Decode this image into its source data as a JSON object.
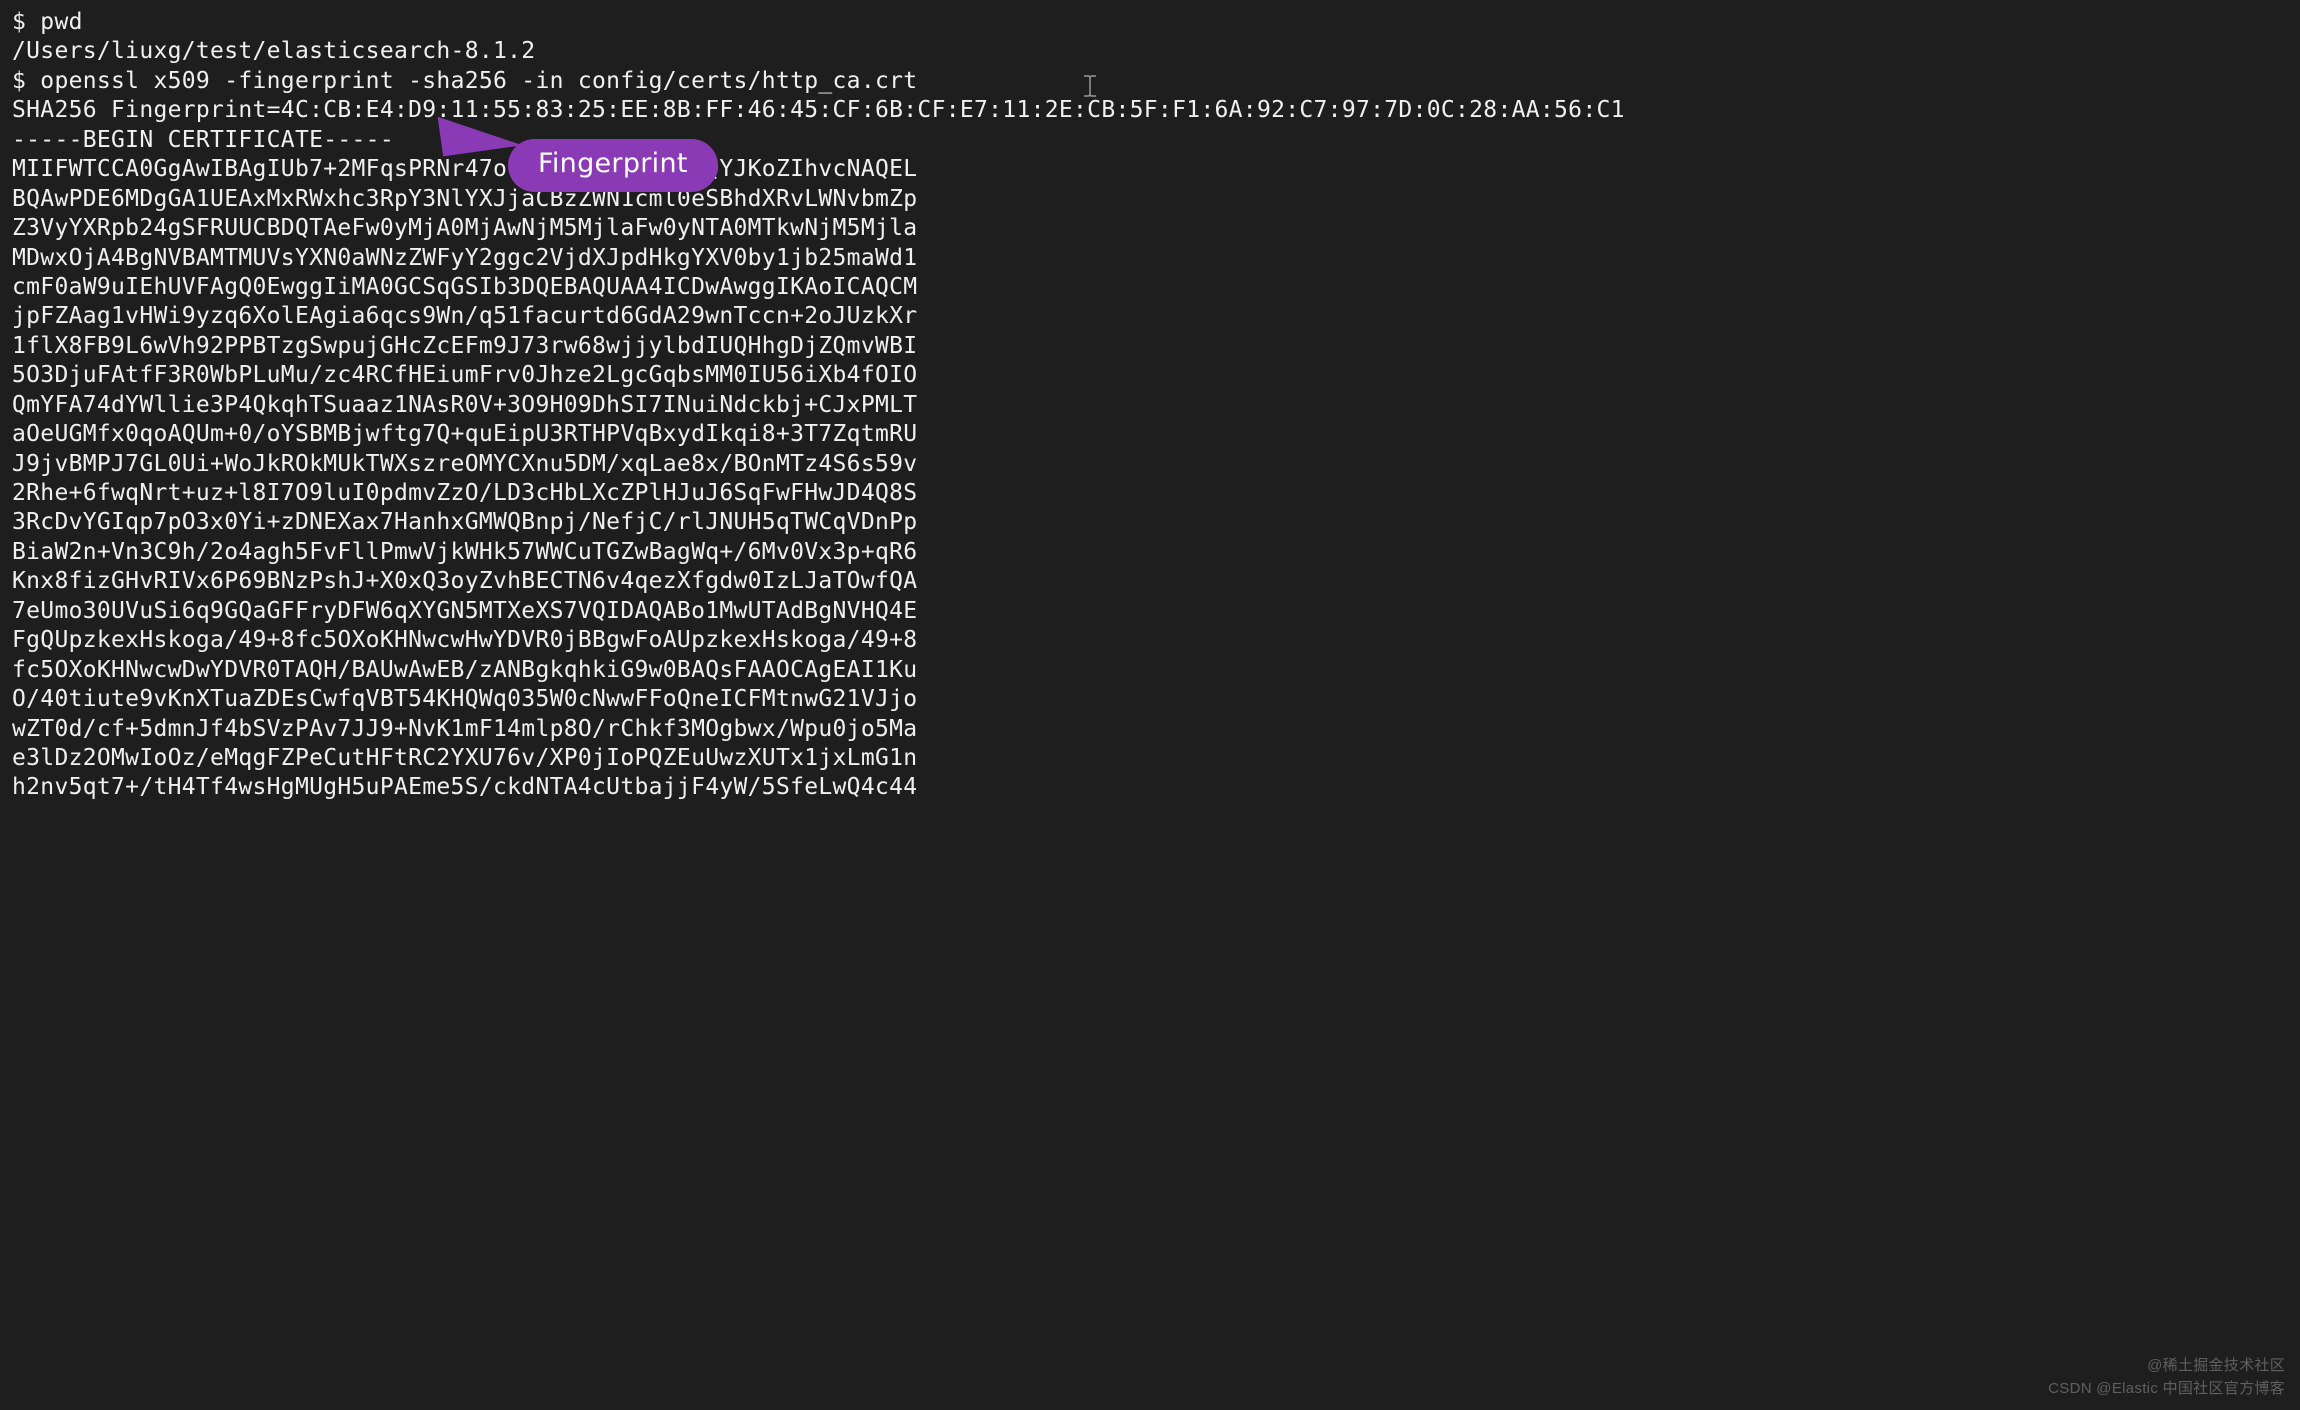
{
  "terminal": {
    "prompt": "$ ",
    "command1": "pwd",
    "output1": "/Users/liuxg/test/elasticsearch-8.1.2",
    "command2": "openssl x509 -fingerprint -sha256 -in config/certs/http_ca.crt",
    "fingerprint_line": "SHA256 Fingerprint=4C:CB:E4:D9:11:55:83:25:EE:8B:FF:46:45:CF:6B:CF:E7:11:2E:CB:5F:F1:6A:92:C7:97:7D:0C:28:AA:56:C1",
    "cert_begin": "-----BEGIN CERTIFICATE-----",
    "cert_lines": [
      "MIIFWTCCA0GgAwIBAgIUb7+2MFqsPRNr47o6OavB1wXnwm4wDQYJKoZIhvcNAQEL",
      "BQAwPDE6MDgGA1UEAxMxRWxhc3RpY3NlYXJjaCBzZWN1cml0eSBhdXRvLWNvbmZp",
      "Z3VyYXRpb24gSFRUUCBDQTAeFw0yMjA0MjAwNjM5MjlaFw0yNTA0MTkwNjM5Mjla",
      "MDwxOjA4BgNVBAMTMUVsYXN0aWNzZWFyY2ggc2VjdXJpdHkgYXV0by1jb25maWd1",
      "cmF0aW9uIEhUVFAgQ0EwggIiMA0GCSqGSIb3DQEBAQUAA4ICDwAwggIKAoICAQCM",
      "jpFZAag1vHWi9yzq6XolEAgia6qcs9Wn/q51facurtd6GdA29wnTccn+2oJUzkXr",
      "1flX8FB9L6wVh92PPBTzgSwpujGHcZcEFm9J73rw68wjjylbdIUQHhgDjZQmvWBI",
      "5O3DjuFAtfF3R0WbPLuMu/zc4RCfHEiumFrv0Jhze2LgcGqbsMM0IU56iXb4fOIO",
      "QmYFA74dYWllie3P4QkqhTSuaaz1NAsR0V+3O9H09DhSI7INuiNdckbj+CJxPMLT",
      "aOeUGMfx0qoAQUm+0/oYSBMBjwftg7Q+quEipU3RTHPVqBxydIkqi8+3T7ZqtmRU",
      "J9jvBMPJ7GL0Ui+WoJkROkMUkTWXszreOMYCXnu5DM/xqLae8x/BOnMTz4S6s59v",
      "2Rhe+6fwqNrt+uz+l8I7O9luI0pdmvZzO/LD3cHbLXcZPlHJuJ6SqFwFHwJD4Q8S",
      "3RcDvYGIqp7pO3x0Yi+zDNEXax7HanhxGMWQBnpj/NefjC/rlJNUH5qTWCqVDnPp",
      "BiaW2n+Vn3C9h/2o4agh5FvFllPmwVjkWHk57WWCuTGZwBagWq+/6Mv0Vx3p+qR6",
      "Knx8fizGHvRIVx6P69BNzPshJ+X0xQ3oyZvhBECTN6v4qezXfgdw0IzLJaTOwfQA",
      "7eUmo30UVuSi6q9GQaGFFryDFW6qXYGN5MTXeXS7VQIDAQABo1MwUTAdBgNVHQ4E",
      "FgQUpzkexHskoga/49+8fc5OXoKHNwcwHwYDVR0jBBgwFoAUpzkexHskoga/49+8",
      "fc5OXoKHNwcwDwYDVR0TAQH/BAUwAwEB/zANBgkqhkiG9w0BAQsFAAOCAgEAI1Ku",
      "O/40tiute9vKnXTuaZDEsCwfqVBT54KHQWq035W0cNwwFFoQneICFMtnwG21VJjo",
      "wZT0d/cf+5dmnJf4bSVzPAv7JJ9+NvK1mF14mlp8O/rChkf3MOgbwx/Wpu0jo5Ma",
      "e3lDz2OMwIoOz/eMqgFZPeCutHFtRC2YXU76v/XP0jIoPQZEuUwzXUTx1jxLmG1n",
      "h2nv5qt7+/tH4Tf4wsHgMUgH5uPAEme5S/ckdNTA4cUtbajjF4yW/5SfeLwQ4c44"
    ]
  },
  "callout": {
    "label": "Fingerprint"
  },
  "watermark": {
    "line1": "@稀土掘金技术社区",
    "line2": "CSDN @Elastic 中国社区官方博客"
  }
}
